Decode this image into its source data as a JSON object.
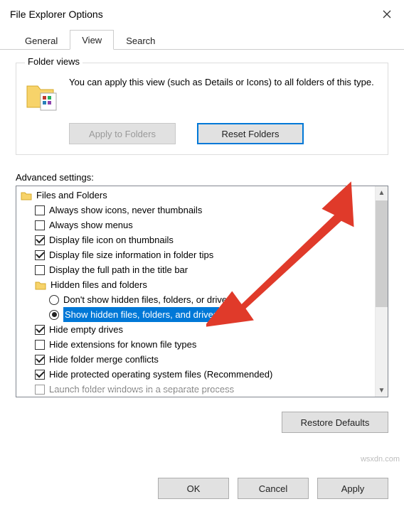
{
  "window": {
    "title": "File Explorer Options"
  },
  "tabs": {
    "general": "General",
    "view": "View",
    "search": "Search"
  },
  "folderViews": {
    "legend": "Folder views",
    "text": "You can apply this view (such as Details or Icons) to all folders of this type.",
    "applyBtn": "Apply to Folders",
    "resetBtn": "Reset Folders"
  },
  "advanced": {
    "label": "Advanced settings:",
    "groupFilesFolders": "Files and Folders",
    "items": {
      "alwaysIcons": "Always show icons, never thumbnails",
      "alwaysMenus": "Always show menus",
      "displayFileIcon": "Display file icon on thumbnails",
      "displayFileSize": "Display file size information in folder tips",
      "displayFullPath": "Display the full path in the title bar",
      "hiddenGroup": "Hidden files and folders",
      "dontShowHidden": "Don't show hidden files, folders, or drives",
      "showHidden": "Show hidden files, folders, and drives",
      "hideEmpty": "Hide empty drives",
      "hideExt": "Hide extensions for known file types",
      "hideMerge": "Hide folder merge conflicts",
      "hideProtected": "Hide protected operating system files (Recommended)",
      "launchSeparate": "Launch folder windows in a separate process"
    },
    "restoreBtn": "Restore Defaults"
  },
  "buttons": {
    "ok": "OK",
    "cancel": "Cancel",
    "apply": "Apply"
  },
  "watermark": "wsxdn.com"
}
